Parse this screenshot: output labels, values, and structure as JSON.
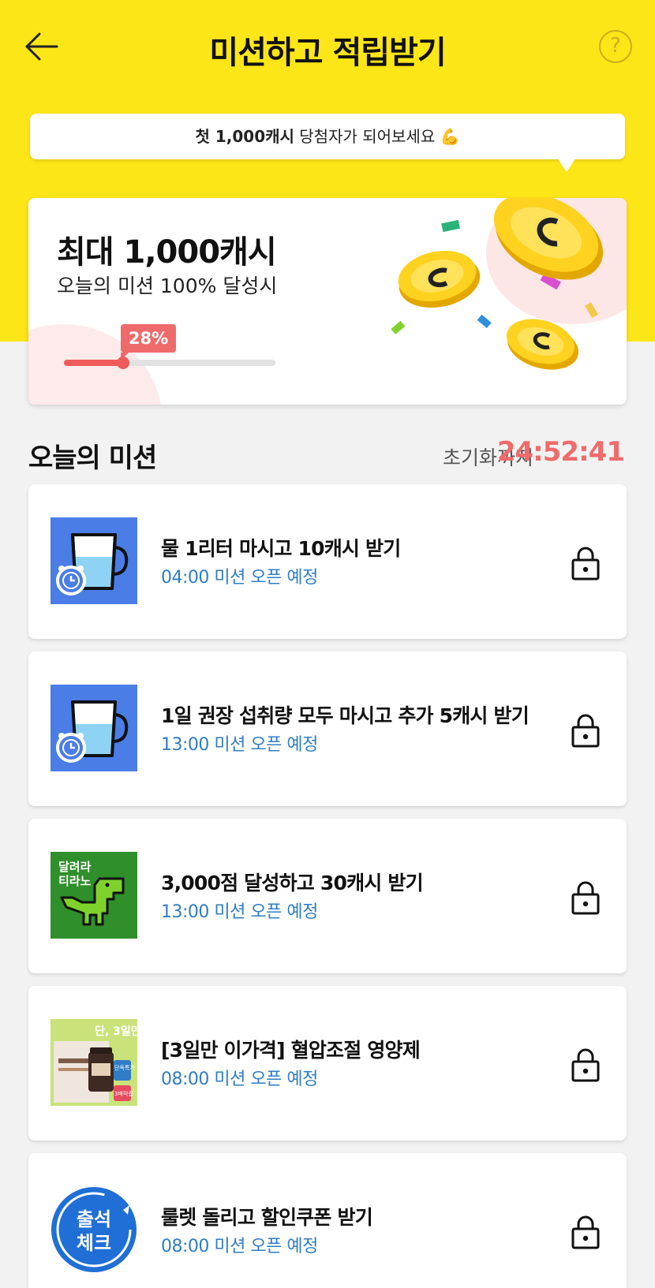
{
  "header": {
    "title": "미션하고 적립받기",
    "help_label": "?"
  },
  "bubble": {
    "highlight": "첫 1,000캐시",
    "text": " 당첨자가 되어보세요 💪"
  },
  "hero": {
    "amount": "최대 1,000캐시",
    "subtitle": "오늘의 미션 100% 달성시",
    "progress_label": "28%",
    "progress_value": 0.28
  },
  "section": {
    "title": "오늘의 미션",
    "reset_label": "초기화까지",
    "reset_time": "24:52:41"
  },
  "missions": [
    {
      "title": "물 1리터 마시고 10캐시 받기",
      "status": "04:00 미션 오픈 예정",
      "icon": "water-cup-alarm-icon"
    },
    {
      "title": "1일 권장 섭취량 모두 마시고 추가 5캐시 받기",
      "status": "13:00 미션 오픈 예정",
      "icon": "water-cup-alarm-icon"
    },
    {
      "title": "3,000점 달성하고 30캐시 받기",
      "status": "13:00 미션 오픈 예정",
      "icon": "dino-game-icon",
      "thumb_text": [
        "달려라",
        "티라노"
      ]
    },
    {
      "title": "[3일만 이가격] 혈압조절 영양제",
      "status": "08:00 미션 오픈 예정",
      "icon": "supplement-ad-icon",
      "thumb_text": [
        "단, 3일만!",
        "단독특가",
        "3배적립"
      ]
    },
    {
      "title": "룰렛 돌리고 할인쿠폰 받기",
      "status": "08:00 미션 오픈 예정",
      "icon": "attendance-check-icon",
      "thumb_text": [
        "출석",
        "체크"
      ]
    }
  ],
  "colors": {
    "brand_yellow": "#fde617",
    "accent_red": "#ef6b6b",
    "status_blue": "#2f7dc4"
  }
}
